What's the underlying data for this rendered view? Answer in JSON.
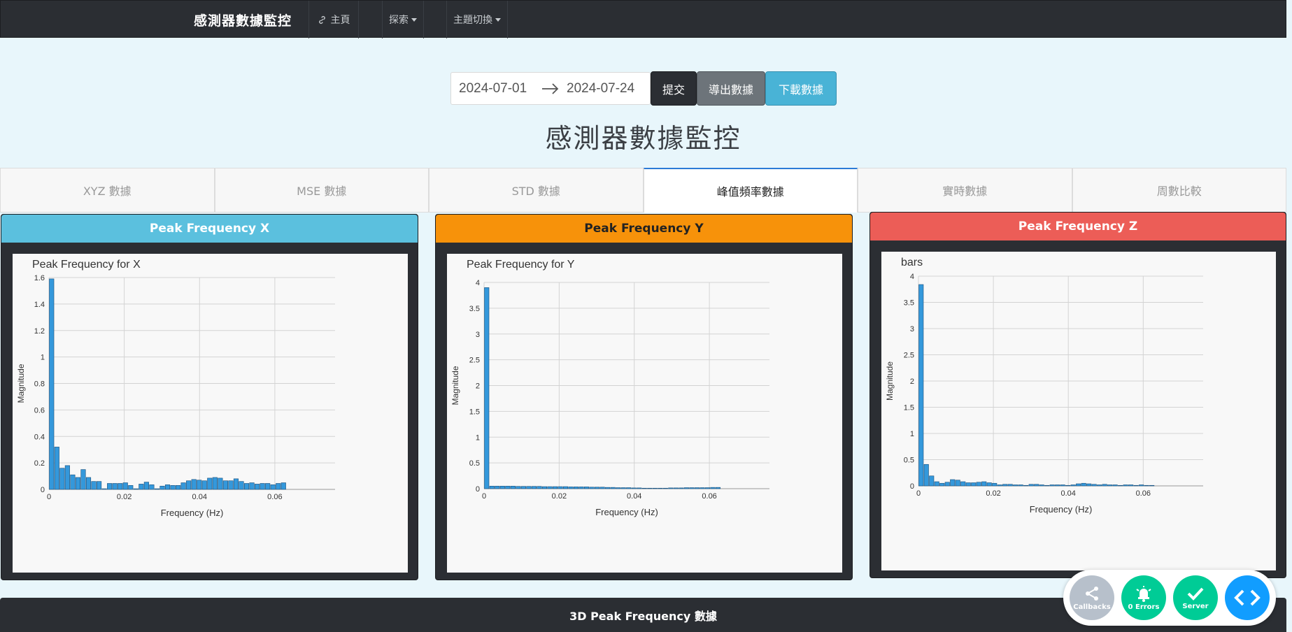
{
  "navbar": {
    "brand": "感測器數據監控",
    "home": "主頁",
    "explore": "探索",
    "theme": "主題切換"
  },
  "controls": {
    "date_start": "2024-07-01",
    "date_end": "2024-07-24",
    "submit": "提交",
    "export": "導出數據",
    "download": "下載數據"
  },
  "page_title": "感測器數據監控",
  "tabs": [
    "XYZ 數據",
    "MSE 數據",
    "STD 數據",
    "峰值頻率數據",
    "實時數據",
    "周數比較"
  ],
  "active_tab": 3,
  "panels": [
    {
      "title": "Peak Frequency X",
      "color": "#5bc0de",
      "title_color": "#ffffff"
    },
    {
      "title": "Peak Frequency Y",
      "color": "#f7920a",
      "title_color": "#222222"
    },
    {
      "title": "Peak Frequency Z",
      "color": "#ec5d57",
      "title_color": "#ffffff"
    }
  ],
  "chart_data": [
    {
      "type": "bar",
      "title": "Peak Frequency for X",
      "xlabel": "Frequency (Hz)",
      "ylabel": "Magnitude",
      "xlim": [
        0,
        0.076
      ],
      "ylim": [
        0,
        1.6
      ],
      "xticks": [
        0,
        0.02,
        0.04,
        0.06
      ],
      "xtick_labels": [
        "0",
        "0.02",
        "0.04",
        "0.06"
      ],
      "yticks": [
        0,
        0.2,
        0.4,
        0.6,
        0.8,
        1,
        1.2,
        1.4,
        1.6
      ],
      "ytick_labels": [
        "0",
        "0.2",
        "0.4",
        "0.6",
        "0.8",
        "1",
        "1.2",
        "1.4",
        "1.6"
      ],
      "x_start": 0,
      "x_step": 0.0014,
      "values": [
        1.59,
        0.32,
        0.16,
        0.18,
        0.11,
        0.09,
        0.15,
        0.09,
        0.06,
        0.06,
        0.005,
        0.045,
        0.045,
        0.045,
        0.05,
        0.03,
        0.005,
        0.04,
        0.055,
        0.035,
        0.005,
        0.025,
        0.035,
        0.03,
        0.03,
        0.05,
        0.065,
        0.075,
        0.07,
        0.065,
        0.085,
        0.09,
        0.085,
        0.065,
        0.065,
        0.08,
        0.06,
        0.045,
        0.05,
        0.04,
        0.045,
        0.045,
        0.035,
        0.045,
        0.05
      ]
    },
    {
      "type": "bar",
      "title": "Peak Frequency for Y",
      "xlabel": "Frequency (Hz)",
      "ylabel": "Magnitude",
      "xlim": [
        0,
        0.076
      ],
      "ylim": [
        0,
        4
      ],
      "xticks": [
        0,
        0.02,
        0.04,
        0.06
      ],
      "xtick_labels": [
        "0",
        "0.02",
        "0.04",
        "0.06"
      ],
      "yticks": [
        0,
        0.5,
        1,
        1.5,
        2,
        2.5,
        3,
        3.5,
        4
      ],
      "ytick_labels": [
        "0",
        "0.5",
        "1",
        "1.5",
        "2",
        "2.5",
        "3",
        "3.5",
        "4"
      ],
      "x_start": 0,
      "x_step": 0.0014,
      "values": [
        3.9,
        0.05,
        0.05,
        0.05,
        0.05,
        0.05,
        0.045,
        0.045,
        0.045,
        0.045,
        0.045,
        0.04,
        0.04,
        0.04,
        0.04,
        0.04,
        0.035,
        0.035,
        0.035,
        0.035,
        0.03,
        0.03,
        0.03,
        0.025,
        0.025,
        0.02,
        0.02,
        0.02,
        0.015,
        0.015,
        0.01,
        0.01,
        0.01,
        0.01,
        0.01,
        0.015,
        0.015,
        0.015,
        0.02,
        0.02,
        0.02,
        0.02,
        0.02,
        0.025,
        0.025
      ]
    },
    {
      "type": "bar",
      "title": "bars",
      "xlabel": "Frequency (Hz)",
      "ylabel": "Magnitude",
      "xlim": [
        0,
        0.076
      ],
      "ylim": [
        0,
        4
      ],
      "xticks": [
        0,
        0.02,
        0.04,
        0.06
      ],
      "xtick_labels": [
        "0",
        "0.02",
        "0.04",
        "0.06"
      ],
      "yticks": [
        0,
        0.5,
        1,
        1.5,
        2,
        2.5,
        3,
        3.5,
        4
      ],
      "ytick_labels": [
        "0",
        "0.5",
        "1",
        "1.5",
        "2",
        "2.5",
        "3",
        "3.5",
        "4"
      ],
      "x_start": 0,
      "x_step": 0.0014,
      "values": [
        3.84,
        0.41,
        0.19,
        0.08,
        0.05,
        0.07,
        0.12,
        0.11,
        0.08,
        0.06,
        0.06,
        0.07,
        0.08,
        0.06,
        0.05,
        0.02,
        0.03,
        0.03,
        0.02,
        0.02,
        0.01,
        0.03,
        0.03,
        0.02,
        0.01,
        0.02,
        0.02,
        0.02,
        0.01,
        0.02,
        0.04,
        0.05,
        0.04,
        0.03,
        0.02,
        0.03,
        0.02,
        0.02,
        0.01,
        0.02,
        0.02,
        0.01,
        0.02,
        0.01,
        0.01
      ]
    }
  ],
  "bottom_title": "3D Peak Frequency 數據",
  "debug": {
    "callbacks": "Callbacks",
    "errors": "0 Errors",
    "server": "Server"
  }
}
